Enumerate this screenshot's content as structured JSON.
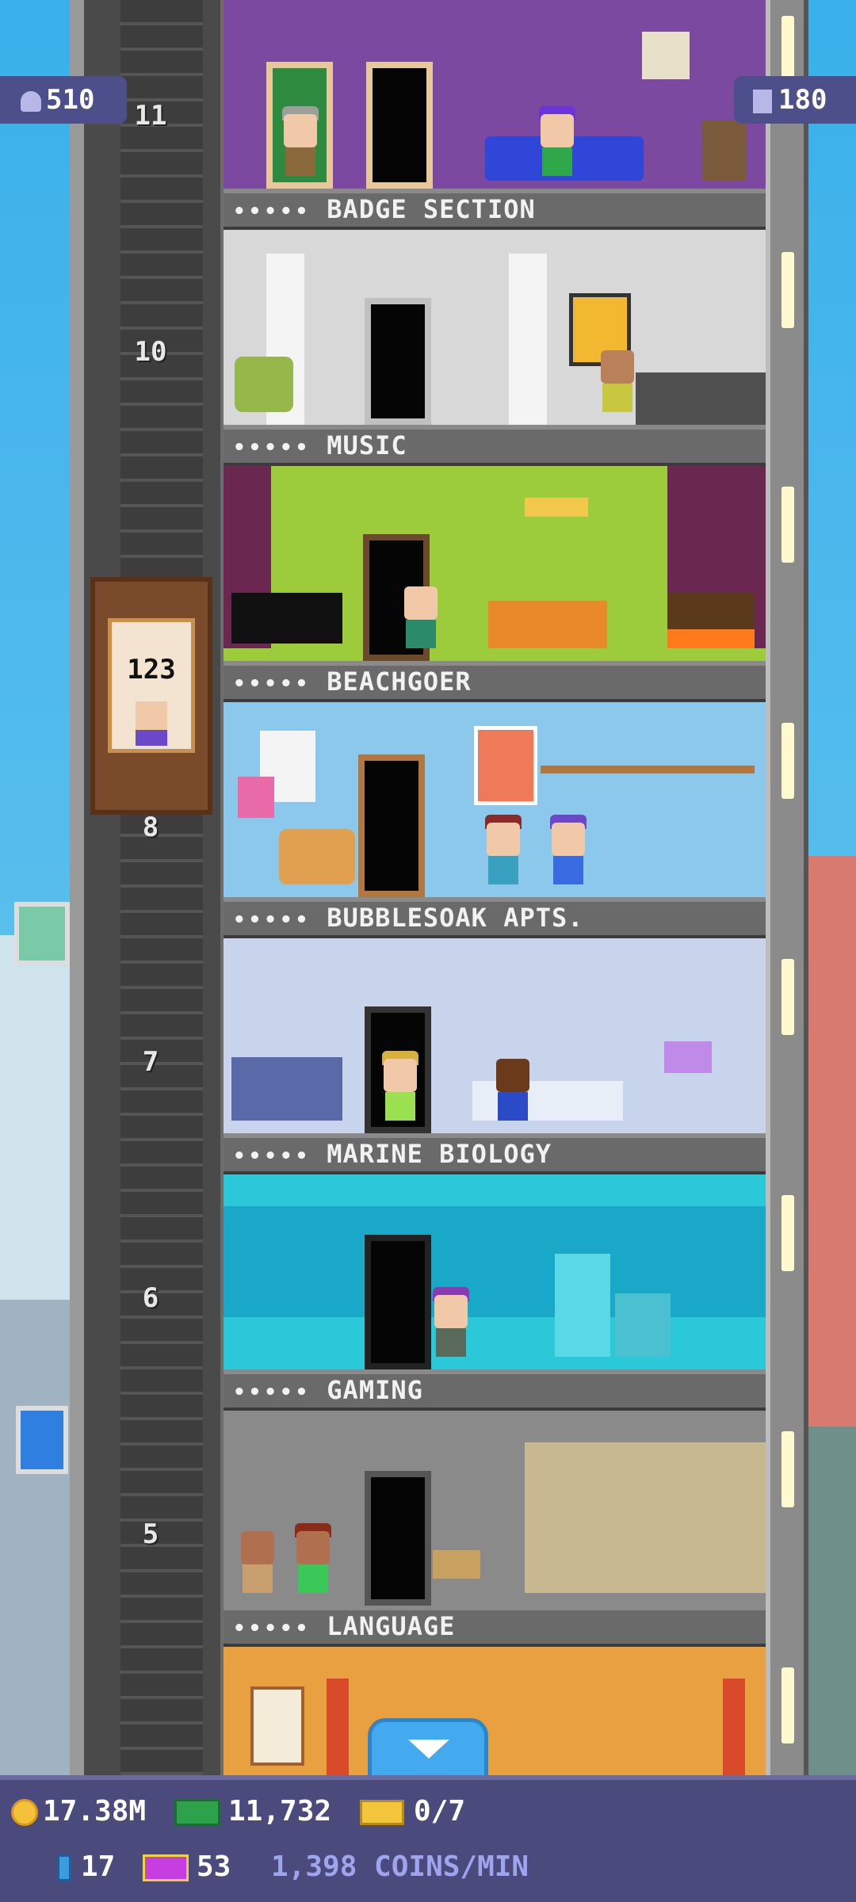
{
  "hud_top": {
    "population": "510",
    "floors": "180"
  },
  "elevator": {
    "count": "123"
  },
  "floor_numbers": [
    "11",
    "10",
    "8",
    "7",
    "6",
    "5"
  ],
  "floors": [
    {
      "name": "BADGE SECTION",
      "dots": "•••••"
    },
    {
      "name": "MUSIC",
      "dots": "•••••"
    },
    {
      "name": "BEACHGOER",
      "dots": "•••••"
    },
    {
      "name": "BUBBLESOAK APTS.",
      "dots": "•••••"
    },
    {
      "name": "MARINE BIOLOGY",
      "dots": "•••••"
    },
    {
      "name": "GAMING",
      "dots": "•••••"
    },
    {
      "name": "LANGUAGE",
      "dots": "•••••"
    }
  ],
  "hud_bottom": {
    "coins": "17.38M",
    "bux": "11,732",
    "tickets": "0/7",
    "keys": "17",
    "tower_bux": "53",
    "rate": "1,398 COINS/MIN"
  },
  "colors": {
    "hud_bg": "#4b4a7c",
    "rate_text": "#9fa4ee",
    "button": "#44aaf0"
  }
}
